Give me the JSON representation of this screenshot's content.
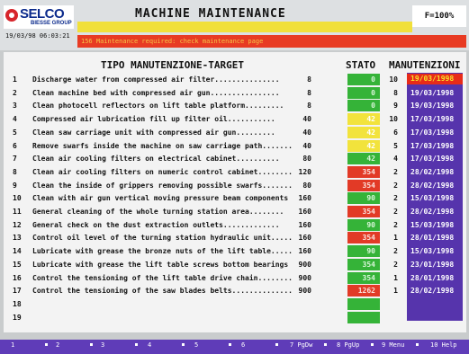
{
  "header": {
    "logo": "SELCO",
    "logo_sub": "BIESSE GROUP",
    "datetime": "19/03/98  06:03:21",
    "title": "MACHINE MAINTENANCE",
    "feed": "F=100%",
    "alarm": "156 Maintenance required: check maintenance page"
  },
  "columns": {
    "tipo": "TIPO MANUTENZIONE-TARGET",
    "stato": "STATO",
    "manutenzioni": "MANUTENZIONI"
  },
  "colors": {
    "green": "#35b338",
    "yellow": "#f2e33c",
    "red": "#e23a26",
    "date_bg": "#5634ac"
  },
  "rows": [
    {
      "num": "1",
      "desc": "Discharge water from compressed air filter...............",
      "target": "8",
      "stato": "0",
      "color": "green",
      "count": "10",
      "date": "19/03/1998",
      "highlight": true
    },
    {
      "num": "2",
      "desc": "Clean machine bed with compressed air gun................",
      "target": "8",
      "stato": "0",
      "color": "green",
      "count": "8",
      "date": "19/03/1998"
    },
    {
      "num": "3",
      "desc": "Clean photocell reflectors on lift table platform.........",
      "target": "8",
      "stato": "0",
      "color": "green",
      "count": "9",
      "date": "19/03/1998"
    },
    {
      "num": "4",
      "desc": "Compressed air lubrication fill up filter oil...........",
      "target": "40",
      "stato": "42",
      "color": "yellow",
      "count": "10",
      "date": "17/03/1998"
    },
    {
      "num": "5",
      "desc": "Clean saw carriage unit with compressed air gun.........",
      "target": "40",
      "stato": "42",
      "color": "yellow",
      "count": "6",
      "date": "17/03/1998"
    },
    {
      "num": "6",
      "desc": "Remove swarfs inside the machine on saw carriage path.......",
      "target": "40",
      "stato": "42",
      "color": "yellow",
      "count": "5",
      "date": "17/03/1998"
    },
    {
      "num": "7",
      "desc": "Clean air cooling filters on electrical cabinet..........",
      "target": "80",
      "stato": "42",
      "color": "green",
      "count": "4",
      "date": "17/03/1998"
    },
    {
      "num": "8",
      "desc": "Clean air cooling filters on numeric control cabinet........",
      "target": "120",
      "stato": "354",
      "color": "red",
      "count": "2",
      "date": "28/02/1998"
    },
    {
      "num": "9",
      "desc": "Clean the inside of grippers removing possible swarfs.......",
      "target": "80",
      "stato": "354",
      "color": "red",
      "count": "2",
      "date": "28/02/1998"
    },
    {
      "num": "10",
      "desc": "Clean with air gun vertical moving pressure beam components",
      "target": "160",
      "stato": "90",
      "color": "green",
      "count": "2",
      "date": "15/03/1998"
    },
    {
      "num": "11",
      "desc": "General cleaning of the whole turning station area........",
      "target": "160",
      "stato": "354",
      "color": "red",
      "count": "2",
      "date": "28/02/1998"
    },
    {
      "num": "12",
      "desc": "General check on the dust extraction outlets.............",
      "target": "160",
      "stato": "90",
      "color": "green",
      "count": "2",
      "date": "15/03/1998"
    },
    {
      "num": "13",
      "desc": "Control oil level of the turning station hydraulic unit.....",
      "target": "160",
      "stato": "354",
      "color": "red",
      "count": "1",
      "date": "28/01/1998"
    },
    {
      "num": "14",
      "desc": "Lubricate with grease the bronze nuts of the lift table.....",
      "target": "160",
      "stato": "90",
      "color": "green",
      "count": "2",
      "date": "15/03/1998"
    },
    {
      "num": "15",
      "desc": "Lubricate with grease the lift table screws bottom bearings",
      "target": "900",
      "stato": "354",
      "color": "green",
      "count": "2",
      "date": "23/01/1998"
    },
    {
      "num": "16",
      "desc": "Control the tensioning of the lift table drive chain........",
      "target": "900",
      "stato": "354",
      "color": "green",
      "count": "1",
      "date": "28/01/1998"
    },
    {
      "num": "17",
      "desc": "Control the tensioning of the saw blades belts..............",
      "target": "900",
      "stato": "1262",
      "color": "red",
      "count": "1",
      "date": "28/02/1998"
    },
    {
      "num": "18",
      "desc": "",
      "target": "",
      "stato": "",
      "color": "green",
      "count": "",
      "date": ""
    },
    {
      "num": "19",
      "desc": "",
      "target": "",
      "stato": "",
      "color": "green",
      "count": "",
      "date": ""
    }
  ],
  "fkeys": [
    {
      "label": "1"
    },
    {
      "label": "2"
    },
    {
      "label": "3"
    },
    {
      "label": "4"
    },
    {
      "label": "5"
    },
    {
      "label": "6"
    },
    {
      "label": "7 PgDw"
    },
    {
      "label": "8 PgUp"
    },
    {
      "label": "9 Menu"
    },
    {
      "label": "10 Help"
    }
  ]
}
